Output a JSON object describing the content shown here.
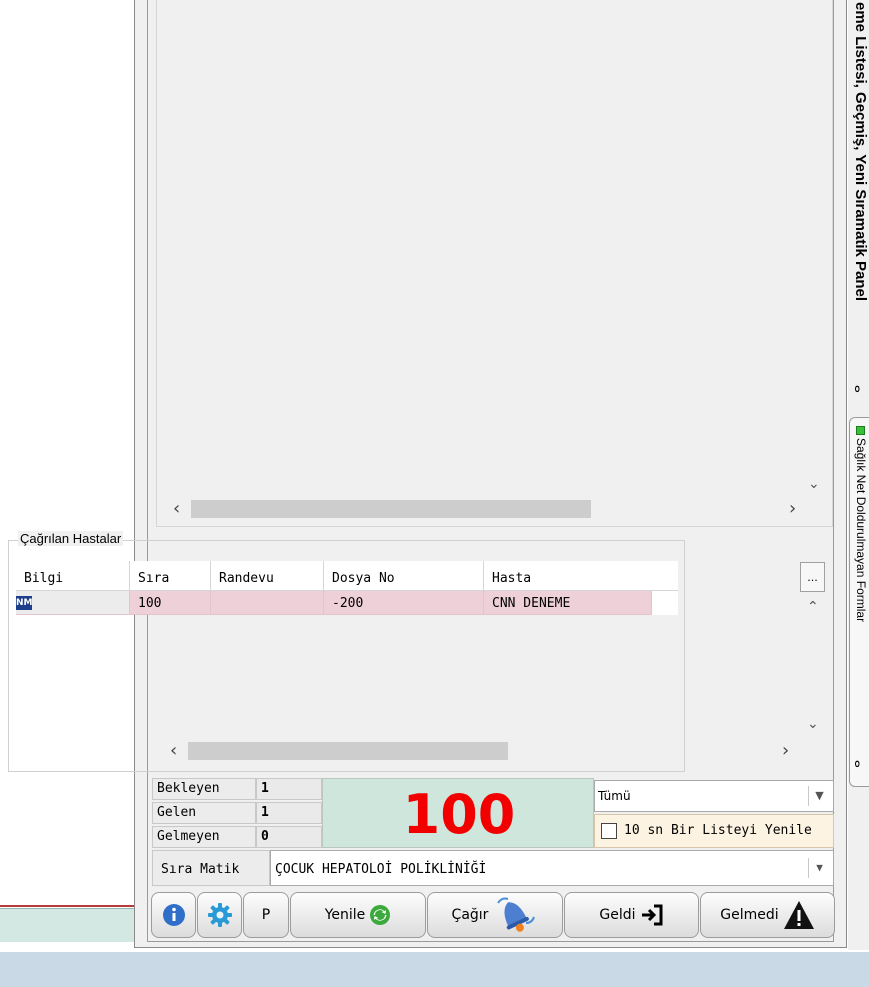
{
  "right_tabs": {
    "panel_title": "eme Listesi, Geçmiş, Yeni Sıramatik Panel",
    "pin_glyph": "ⴰ",
    "form_tab": "Sağlık Net Doldurulmayan Formlar"
  },
  "called_patients": {
    "title": "Çağrılan Hastalar",
    "columns": [
      "Bilgi",
      "Sıra",
      "Randevu",
      "Dosya No",
      "Hasta"
    ],
    "rows": [
      {
        "bilgi_icon": "NM",
        "sira": "100",
        "randevu": "",
        "dosya_no": "-200",
        "hasta": "CNN DENEME"
      }
    ],
    "more_button": "..."
  },
  "stats": {
    "bekleyen_label": "Bekleyen",
    "bekleyen_value": "1",
    "gelen_label": "Gelen",
    "gelen_value": "1",
    "gelmeyen_label": "Gelmeyen",
    "gelmeyen_value": "0"
  },
  "current_number": "100",
  "filter": {
    "selected": "Tümü"
  },
  "auto_refresh": {
    "label": "10 sn Bir Listeyi Yenile",
    "checked": false
  },
  "sira_matik": {
    "label": "Sıra Matik",
    "selected": "ÇOCUK HEPATOLOİ POLİKLİNİĞİ"
  },
  "toolbar": {
    "p_label": "P",
    "refresh_label": "Yenile",
    "call_label": "Çağır",
    "arrived_label": "Geldi",
    "not_arrived_label": "Gelmedi"
  },
  "colors": {
    "big_number": "#f20000",
    "row_highlight": "#edd0d8",
    "number_bg": "#cfe6dc"
  }
}
